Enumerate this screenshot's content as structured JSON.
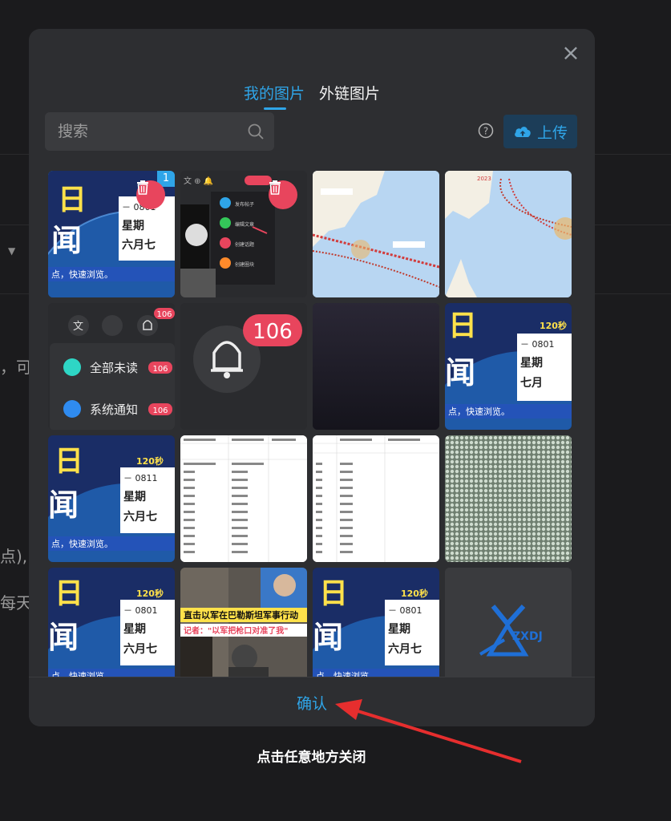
{
  "background": {
    "frag1": "，可",
    "frag2": "点),",
    "frag3": "每天"
  },
  "modal": {
    "tabs": [
      {
        "label": "我的图片",
        "active": true
      },
      {
        "label": "外链图片",
        "active": false
      }
    ],
    "search": {
      "placeholder": "搜索"
    },
    "upload_label": "上传",
    "confirm_label": "确认"
  },
  "grid": {
    "selected_index": "1",
    "news_card": {
      "title_top": "日",
      "title_bottom": "闻",
      "seconds_tag": "120秒",
      "date_08": "－ 0801",
      "date_0811": "－ 0811",
      "weekday": "星期",
      "month6": "六月七",
      "month7": "七月",
      "caption": "点，快速浏览。"
    },
    "notif": {
      "count": "106",
      "all_unread": "全部未读",
      "system_notice": "系统通知"
    },
    "screenshot_menu": {
      "items": [
        "发布帖子",
        "编辑文章",
        "创建话题",
        "创建圈块"
      ]
    },
    "video_caption_1": "直击以军在巴勒斯坦军事行动",
    "video_caption_2": "记者：\"以军把枪口对准了我\"",
    "logo_text": "ZXDJ"
  },
  "hint": "点击任意地方关闭",
  "colors": {
    "accent": "#2fa5e8",
    "danger": "#e8455d",
    "modal_bg": "#2d2e31"
  }
}
